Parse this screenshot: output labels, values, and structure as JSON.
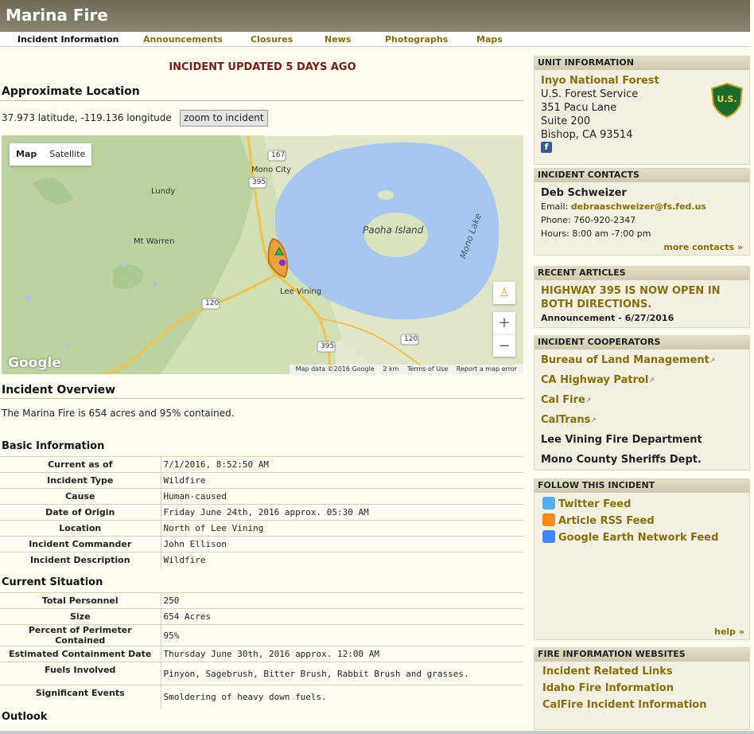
{
  "header": {
    "title": "Marina Fire"
  },
  "tabs": [
    "Incident Information",
    "Announcements",
    "Closures",
    "News",
    "Photographs",
    "Maps"
  ],
  "main": {
    "updated": "INCIDENT UPDATED 5 DAYS AGO",
    "location_title": "Approximate Location",
    "latlong": "37.973 latitude, -119.136 longitude",
    "zoom_button": "zoom to incident",
    "map": {
      "type_map": "Map",
      "type_satellite": "Satellite",
      "labels": [
        "Mono City",
        "Lundy",
        "Mt Warren",
        "Paoha Island",
        "Mono Lake",
        "Lee Vining"
      ],
      "shields": [
        "167",
        "395",
        "120",
        "395",
        "120"
      ],
      "logo": "Google",
      "footer": [
        "Map data ©2016 Google",
        "2 km",
        "Terms of Use",
        "Report a map error"
      ],
      "zoom_in": "+",
      "zoom_out": "−"
    },
    "overview_title": "Incident Overview",
    "overview_text": "The Marina Fire is 654 acres and 95% contained.",
    "basic_title": "Basic Information",
    "basic_rows": [
      {
        "k": "Current as of",
        "v": "7/1/2016, 8:52:50 AM"
      },
      {
        "k": "Incident Type",
        "v": "Wildfire"
      },
      {
        "k": "Cause",
        "v": "Human-caused"
      },
      {
        "k": "Date of Origin",
        "v": "Friday June 24th, 2016 approx. 05:30 AM"
      },
      {
        "k": "Location",
        "v": "North of Lee Vining"
      },
      {
        "k": "Incident Commander",
        "v": "John Ellison"
      },
      {
        "k": "Incident Description",
        "v": "Wildfire"
      }
    ],
    "situation_title": "Current Situation",
    "situation_rows": [
      {
        "k": "Total Personnel",
        "v": "250"
      },
      {
        "k": "Size",
        "v": "654 Acres"
      },
      {
        "k": "Percent of Perimeter Contained",
        "v": "95%"
      },
      {
        "k": "Estimated Containment Date",
        "v": "Thursday June 30th, 2016 approx. 12:00 AM"
      },
      {
        "k": "Fuels Involved",
        "v": "Pinyon, Sagebrush, Bitter Brush, Rabbit Brush and grasses."
      },
      {
        "k": "Significant Events",
        "v": "Smoldering of heavy down fuels."
      }
    ],
    "outlook_title": "Outlook"
  },
  "sidebar": {
    "unit": {
      "title": "UNIT INFORMATION",
      "name": "Inyo National Forest",
      "lines": [
        "U.S. Forest Service",
        "351 Pacu Lane",
        "Suite 200",
        "Bishop, CA 93514"
      ],
      "badge_text": "U.S."
    },
    "contacts": {
      "title": "INCIDENT CONTACTS",
      "name": "Deb Schweizer",
      "email_label": "Email:",
      "email": "debraaschweizer@fs.fed.us",
      "phone": "Phone: 760-920-2347",
      "hours": "Hours: 8:00 am -7:00 pm",
      "more": "more contacts »"
    },
    "articles": {
      "title": "RECENT ARTICLES",
      "headline": "HIGHWAY 395 IS NOW OPEN IN BOTH DIRECTIONS.",
      "meta": "Announcement - 6/27/2016"
    },
    "cooperators": {
      "title": "INCIDENT COOPERATORS",
      "items": [
        "Bureau of Land Management",
        "CA Highway Patrol",
        "Cal Fire",
        "CalTrans",
        "Lee Vining Fire Department",
        "Mono County Sheriffs Dept."
      ]
    },
    "follow": {
      "title": "FOLLOW THIS INCIDENT",
      "items": [
        "Twitter Feed",
        "Article RSS Feed",
        "Google Earth Network Feed"
      ],
      "help": "help »"
    },
    "websites": {
      "title": "FIRE INFORMATION WEBSITES",
      "items": [
        "Incident Related Links",
        "Idaho Fire Information",
        "CalFire Incident Information"
      ]
    }
  },
  "colors": {
    "accent": "#8a6d0a",
    "alert": "#7a1a10",
    "header": "#7a7560"
  }
}
